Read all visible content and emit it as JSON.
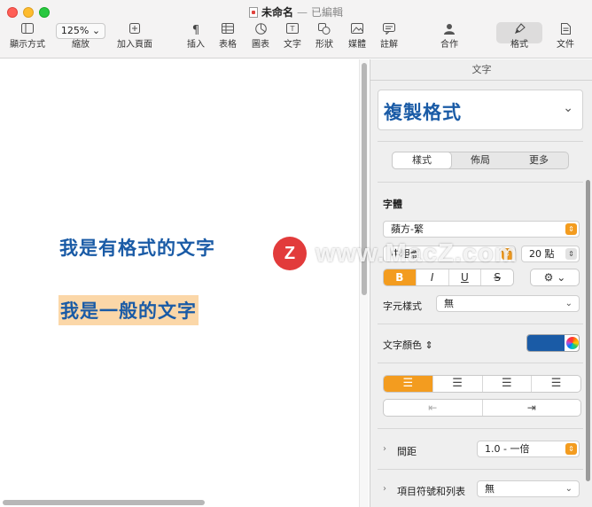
{
  "window": {
    "title": "未命名",
    "separator": "—",
    "status": "已編輯"
  },
  "toolbar": {
    "view": {
      "label": "顯示方式",
      "icon": "sidebar-icon"
    },
    "zoom": {
      "label": "縮放",
      "value": "125%"
    },
    "add_page": {
      "label": "加入頁面",
      "icon": "add-page-icon"
    },
    "insert": {
      "label": "插入",
      "icon": "paragraph-icon"
    },
    "table": {
      "label": "表格",
      "icon": "table-icon"
    },
    "chart": {
      "label": "圖表",
      "icon": "chart-icon"
    },
    "text": {
      "label": "文字",
      "icon": "text-box-icon"
    },
    "shape": {
      "label": "形狀",
      "icon": "shape-icon"
    },
    "media": {
      "label": "媒體",
      "icon": "media-icon"
    },
    "comment": {
      "label": "註解",
      "icon": "comment-icon"
    },
    "collaborate": {
      "label": "合作",
      "icon": "collaborate-icon"
    },
    "format": {
      "label": "格式",
      "icon": "paintbrush-icon",
      "active": true
    },
    "document": {
      "label": "文件",
      "icon": "document-icon"
    }
  },
  "document": {
    "styled_line": "我是有格式的文字",
    "plain_line": "我是一般的文字",
    "text_color": "#1a5ba6",
    "highlight_color": "#fbd7a8"
  },
  "inspector": {
    "tab": "文字",
    "paragraph_style": "複製格式",
    "segments": [
      "樣式",
      "佈局",
      "更多"
    ],
    "selected_segment": "樣式",
    "font_section": "字體",
    "font_family": "蘋方-繁",
    "font_weight": "中粗體",
    "font_size": "20 點",
    "biu": [
      "B",
      "I",
      "U",
      "S"
    ],
    "char_style_label": "字元樣式",
    "char_style_value": "無",
    "text_color_label": "文字顏色",
    "text_color_value": "#1a5ba6",
    "spacing_label": "間距",
    "spacing_value": "1.0 - 一倍",
    "bullets_label": "項目符號和列表",
    "bullets_value": "無",
    "accent_color": "#f39c1f"
  },
  "watermark": {
    "logo_letter": "Z",
    "text": "www.MacZ.com"
  }
}
